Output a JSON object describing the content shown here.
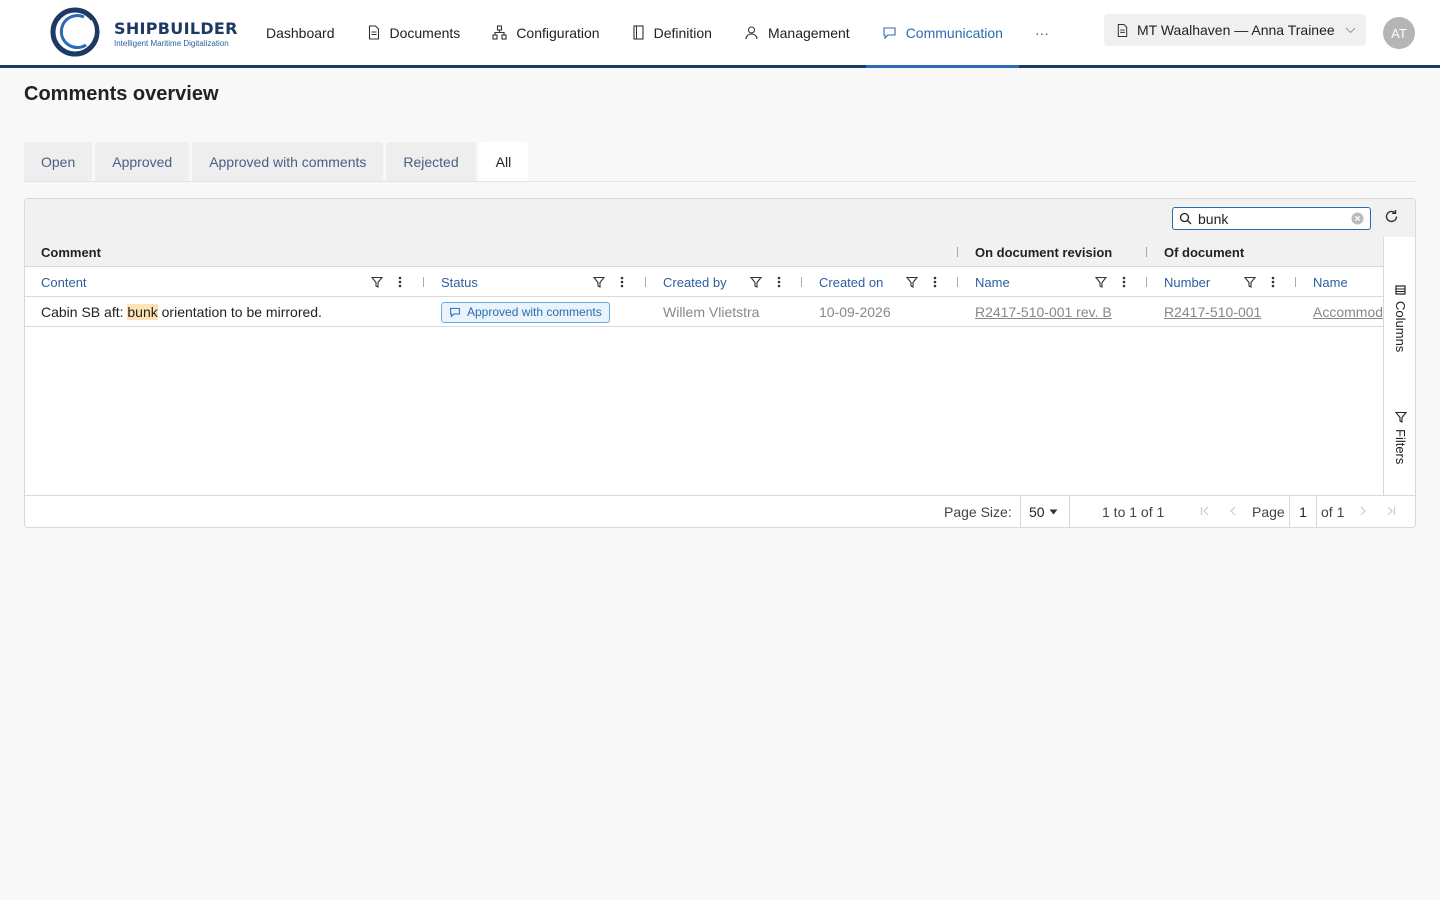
{
  "brand": {
    "name": "SHIPBUILDER",
    "tagline": "Intelligent Maritime Digitalization"
  },
  "nav": {
    "items": [
      {
        "label": "Dashboard",
        "icon": "none",
        "active": false
      },
      {
        "label": "Documents",
        "icon": "document-icon",
        "active": false
      },
      {
        "label": "Configuration",
        "icon": "hierarchy-icon",
        "active": false
      },
      {
        "label": "Definition",
        "icon": "book-icon",
        "active": false
      },
      {
        "label": "Management",
        "icon": "person-icon",
        "active": false
      },
      {
        "label": "Communication",
        "icon": "chat-icon",
        "active": true
      }
    ],
    "more": "···"
  },
  "project": {
    "label": "MT Waalhaven — Anna Trainee"
  },
  "user": {
    "initials": "AT"
  },
  "page": {
    "title": "Comments overview"
  },
  "tabs": [
    {
      "label": "Open",
      "active": false
    },
    {
      "label": "Approved",
      "active": false
    },
    {
      "label": "Approved with comments",
      "active": false
    },
    {
      "label": "Rejected",
      "active": false
    },
    {
      "label": "All",
      "active": true
    }
  ],
  "search": {
    "value": "bunk"
  },
  "grid": {
    "groups": {
      "comment": "Comment",
      "revision": "On document revision",
      "document": "Of document"
    },
    "columns": {
      "content": "Content",
      "status": "Status",
      "created_by": "Created by",
      "created_on": "Created on",
      "rev_name": "Name",
      "doc_number": "Number",
      "doc_name": "Name"
    },
    "rows": [
      {
        "content_before": "Cabin SB aft: ",
        "content_match": "bunk",
        "content_after": " orientation to be mirrored.",
        "status": "Approved with comments",
        "created_by": "Willem Vlietstra",
        "created_on": "10-09-2026",
        "rev_name": "R2417-510-001 rev. B",
        "doc_number": "R2417-510-001",
        "doc_name": "Accommod"
      }
    ],
    "side": {
      "columns": "Columns",
      "filters": "Filters"
    }
  },
  "pagination": {
    "page_size_label": "Page Size:",
    "page_size": "50",
    "range": "1 to 1 of 1",
    "page_label": "Page",
    "page": "1",
    "of": "of 1"
  },
  "colors": {
    "brand_navy": "#1c3a64",
    "accent": "#2c6bb3",
    "highlight": "#fde3b5"
  }
}
